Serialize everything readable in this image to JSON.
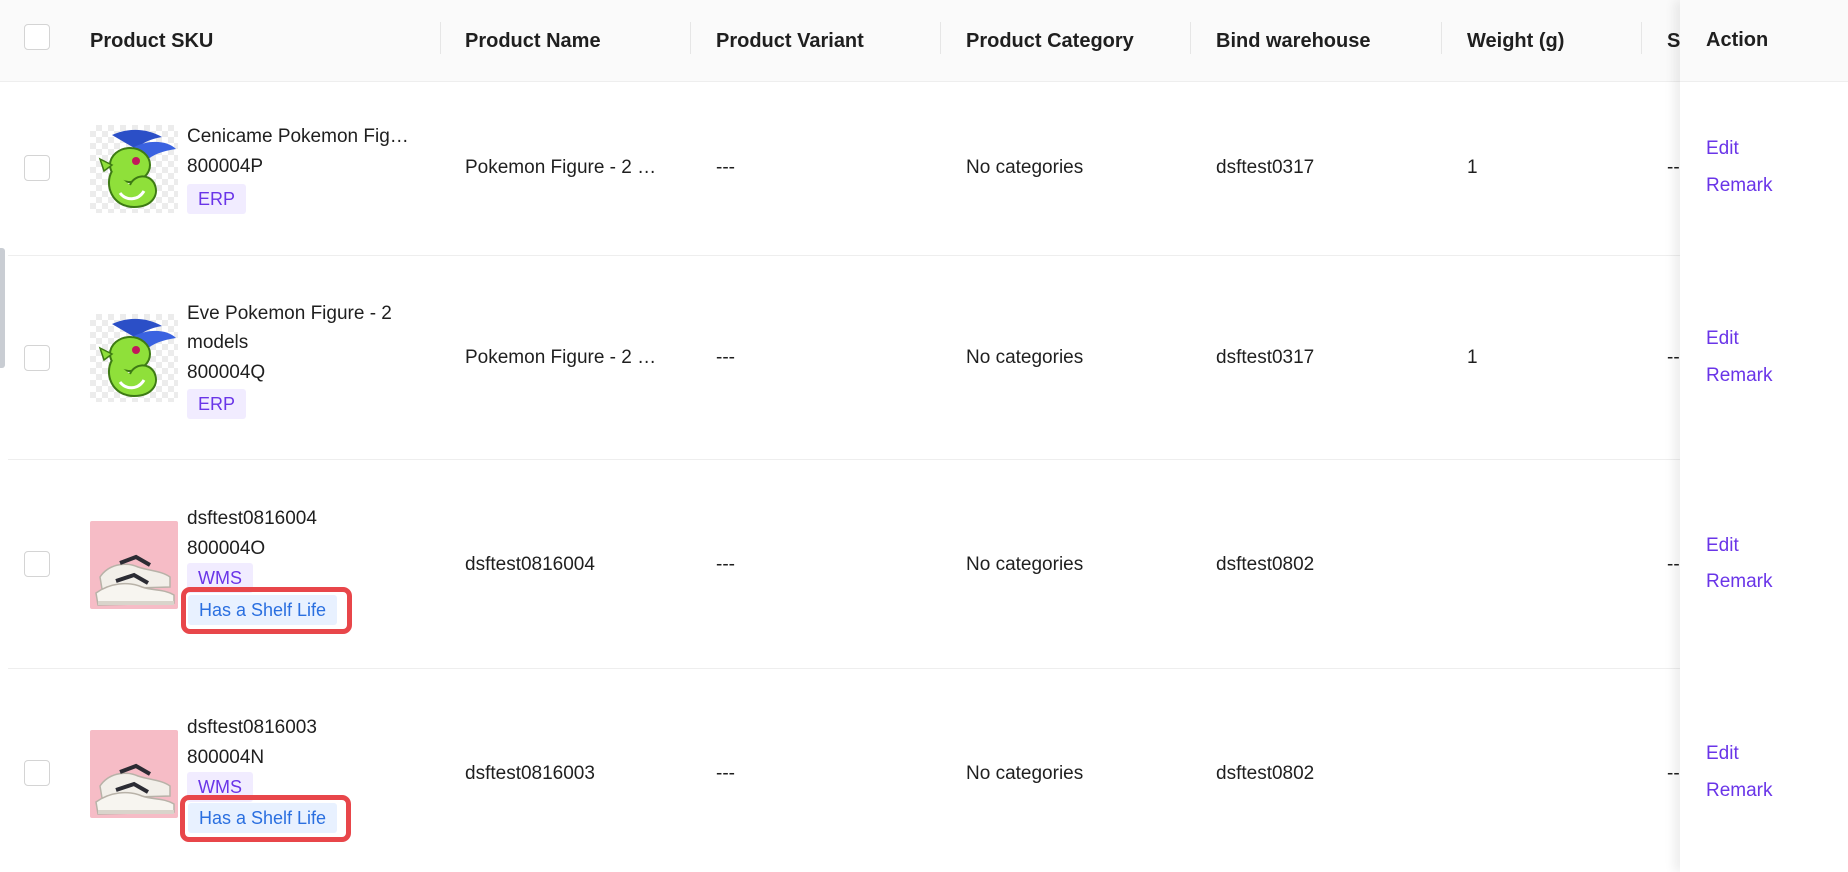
{
  "columns": {
    "sku": "Product SKU",
    "name": "Product Name",
    "variant": "Product Variant",
    "category": "Product Category",
    "warehouse": "Bind warehouse",
    "weight": "Weight (g)",
    "truncated": "S",
    "action": "Action"
  },
  "rows": [
    {
      "title": "Cenicame Pokemon Fig…",
      "sku": "800004P",
      "tags": [
        "ERP"
      ],
      "name": "Pokemon Figure - 2 …",
      "variant": "---",
      "category": "No categories",
      "warehouse": "dsftest0317",
      "weight": "1",
      "extra": "--",
      "image": "pokemon-figure-image"
    },
    {
      "title_line1": "Eve Pokemon Figure - 2",
      "title_line2": "models",
      "sku": "800004Q",
      "tags": [
        "ERP"
      ],
      "name": "Pokemon Figure - 2 …",
      "variant": "---",
      "category": "No categories",
      "warehouse": "dsftest0317",
      "weight": "1",
      "extra": "--",
      "image": "pokemon-figure-image"
    },
    {
      "title": "dsftest0816004",
      "sku": "800004O",
      "tags": [
        "WMS",
        "Has a Shelf Life"
      ],
      "name": "dsftest0816004",
      "variant": "---",
      "category": "No categories",
      "warehouse": "dsftest0802",
      "extra": "--",
      "image": "sneaker-image"
    },
    {
      "title": "dsftest0816003",
      "sku": "800004N",
      "tags": [
        "WMS",
        "Has a Shelf Life"
      ],
      "name": "dsftest0816003",
      "variant": "---",
      "category": "No categories",
      "warehouse": "dsftest0802",
      "extra": "--",
      "image": "sneaker-image"
    }
  ],
  "actions": {
    "edit": "Edit",
    "remark": "Remark"
  },
  "colors": {
    "accent": "#6a35e8",
    "tag_blue": "#2a6fe0",
    "highlight": "#e8464a"
  }
}
